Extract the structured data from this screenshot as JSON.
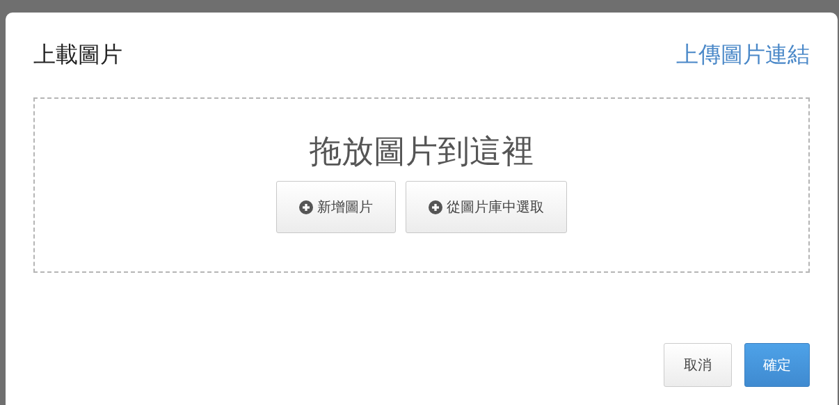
{
  "dialog": {
    "title": "上載圖片",
    "link": "上傳圖片連結"
  },
  "dropzone": {
    "prompt": "拖放圖片到這裡",
    "buttons": [
      {
        "label": "新增圖片"
      },
      {
        "label": "從圖片庫中選取"
      }
    ]
  },
  "footer": {
    "buttons": [
      {
        "label": "取消",
        "kind": "default"
      },
      {
        "label": "確定",
        "kind": "primary"
      }
    ]
  }
}
